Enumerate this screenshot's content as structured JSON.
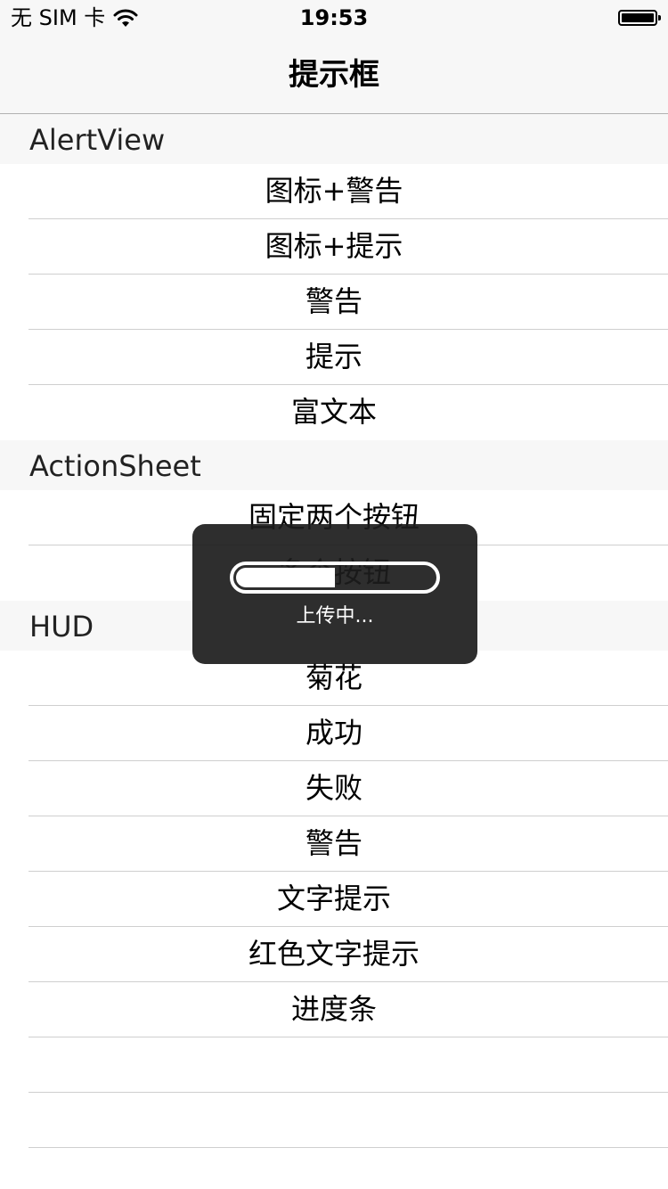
{
  "status_bar": {
    "carrier": "无 SIM 卡",
    "time": "19:53",
    "wifi_icon": "wifi-icon",
    "battery_icon": "battery-icon"
  },
  "nav": {
    "title": "提示框"
  },
  "sections": [
    {
      "header": "AlertView",
      "items": [
        "图标+警告",
        "图标+提示",
        "警告",
        "提示",
        "富文本"
      ]
    },
    {
      "header": "ActionSheet",
      "items": [
        "固定两个按钮",
        "多个按钮"
      ]
    },
    {
      "header": "HUD",
      "items": [
        "菊花",
        "成功",
        "失败",
        "警告",
        "文字提示",
        "红色文字提示",
        "进度条",
        "",
        ""
      ]
    }
  ],
  "hud": {
    "progress": 0.5,
    "text": "上传中..."
  },
  "colors": {
    "bar_background": "#f7f7f7",
    "separator": "#cfcfcf",
    "hud_background": "#1c1c1c"
  }
}
